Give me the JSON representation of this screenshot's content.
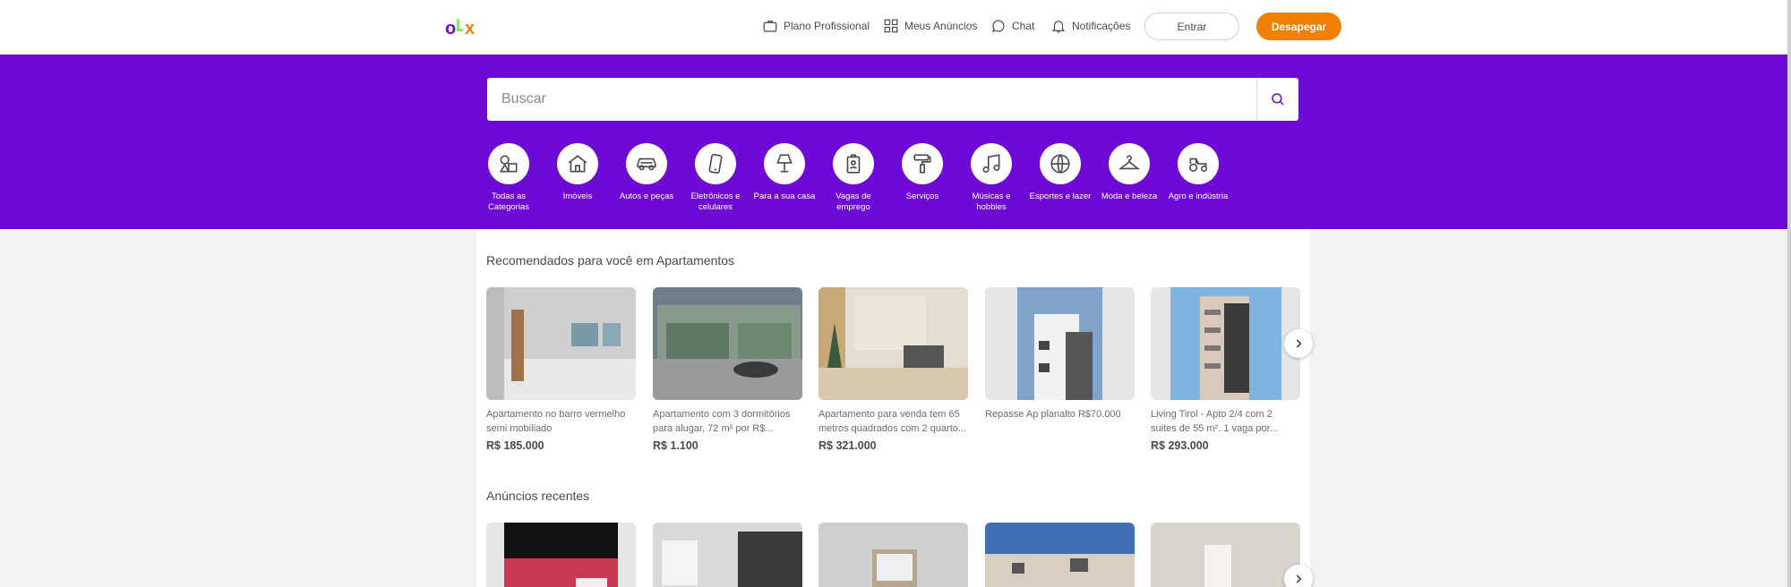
{
  "header": {
    "nav": [
      {
        "label": "Plano Profissional",
        "icon": "briefcase-icon"
      },
      {
        "label": "Meus Anúncios",
        "icon": "grid-icon"
      },
      {
        "label": "Chat",
        "icon": "chat-icon"
      },
      {
        "label": "Notificações",
        "icon": "bell-icon"
      }
    ],
    "login_label": "Entrar",
    "post_label": "Desapegar"
  },
  "search": {
    "placeholder": "Buscar"
  },
  "categories": [
    {
      "label": "Todas as Categorias",
      "icon": "shapes-icon"
    },
    {
      "label": "Imóveis",
      "icon": "house-icon"
    },
    {
      "label": "Autos e peças",
      "icon": "car-icon"
    },
    {
      "label": "Eletrônicos e celulares",
      "icon": "phone-icon"
    },
    {
      "label": "Para a sua casa",
      "icon": "lamp-icon"
    },
    {
      "label": "Vagas de emprego",
      "icon": "badge-icon"
    },
    {
      "label": "Serviços",
      "icon": "paint-roller-icon"
    },
    {
      "label": "Músicas e hobbies",
      "icon": "music-note-icon"
    },
    {
      "label": "Esportes e lazer",
      "icon": "ball-icon"
    },
    {
      "label": "Moda e beleza",
      "icon": "hanger-icon"
    },
    {
      "label": "Agro e indústria",
      "icon": "tractor-icon"
    }
  ],
  "recommended": {
    "title": "Recomendados para você em Apartamentos",
    "items": [
      {
        "title": "Apartamento no barro vermelho semi mobiliado",
        "price": "R$ 185.000"
      },
      {
        "title": "Apartamento com 3 dormitórios para alugar, 72 m² por R$...",
        "price": "R$ 1.100"
      },
      {
        "title": "Apartamento para venda tem 65 metros quadrados com 2 quarto...",
        "price": "R$ 321.000"
      },
      {
        "title": "Repasse Ap planalto R$70.000",
        "price": ""
      },
      {
        "title": "Living Tirol - Apto 2/4 com 2 suites de 55 m². 1 vaga por...",
        "price": "R$ 293.000"
      }
    ]
  },
  "recent": {
    "title": "Anúncios recentes"
  },
  "colors": {
    "brand_purple": "#6e0ad6",
    "brand_orange": "#f28000",
    "brand_green": "#8ce563"
  }
}
